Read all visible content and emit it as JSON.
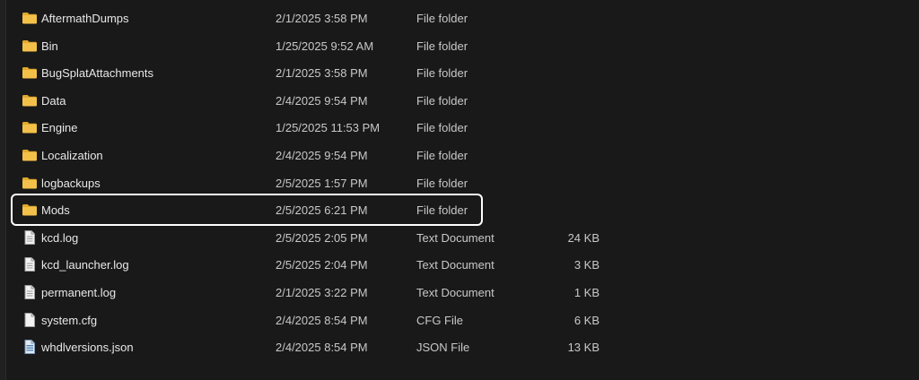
{
  "files": [
    {
      "name": "AftermathDumps",
      "date": "2/1/2025 3:58 PM",
      "type": "File folder",
      "size": "",
      "icon": "folder-icon"
    },
    {
      "name": "Bin",
      "date": "1/25/2025 9:52 AM",
      "type": "File folder",
      "size": "",
      "icon": "folder-icon"
    },
    {
      "name": "BugSplatAttachments",
      "date": "2/1/2025 3:58 PM",
      "type": "File folder",
      "size": "",
      "icon": "folder-icon"
    },
    {
      "name": "Data",
      "date": "2/4/2025 9:54 PM",
      "type": "File folder",
      "size": "",
      "icon": "folder-icon"
    },
    {
      "name": "Engine",
      "date": "1/25/2025 11:53 PM",
      "type": "File folder",
      "size": "",
      "icon": "folder-icon"
    },
    {
      "name": "Localization",
      "date": "2/4/2025 9:54 PM",
      "type": "File folder",
      "size": "",
      "icon": "folder-icon"
    },
    {
      "name": "logbackups",
      "date": "2/5/2025 1:57 PM",
      "type": "File folder",
      "size": "",
      "icon": "folder-icon"
    },
    {
      "name": "Mods",
      "date": "2/5/2025 6:21 PM",
      "type": "File folder",
      "size": "",
      "icon": "folder-icon"
    },
    {
      "name": "kcd.log",
      "date": "2/5/2025 2:05 PM",
      "type": "Text Document",
      "size": "24 KB",
      "icon": "text-document-icon"
    },
    {
      "name": "kcd_launcher.log",
      "date": "2/5/2025 2:04 PM",
      "type": "Text Document",
      "size": "3 KB",
      "icon": "text-document-icon"
    },
    {
      "name": "permanent.log",
      "date": "2/1/2025 3:22 PM",
      "type": "Text Document",
      "size": "1 KB",
      "icon": "text-document-icon"
    },
    {
      "name": "system.cfg",
      "date": "2/4/2025 8:54 PM",
      "type": "CFG File",
      "size": "6 KB",
      "icon": "file-icon"
    },
    {
      "name": "whdlversions.json",
      "date": "2/4/2025 8:54 PM",
      "type": "JSON File",
      "size": "13 KB",
      "icon": "json-file-icon"
    }
  ],
  "highlighted_item": "Mods",
  "colors": {
    "background": "#191919",
    "folder": "#f3c14a",
    "folder_dark": "#e0a92c",
    "highlight_border": "#ffffff"
  }
}
